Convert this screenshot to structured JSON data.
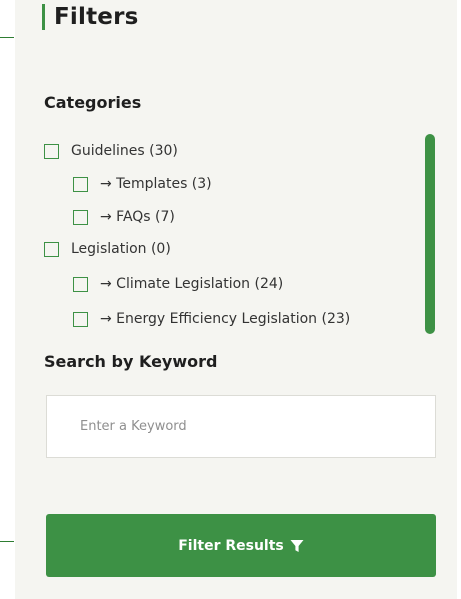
{
  "filters": {
    "title": "Filters",
    "categories_heading": "Categories",
    "categories": [
      {
        "label": "Guidelines (30)",
        "checked": false
      },
      {
        "label": "→ Templates (3)",
        "checked": false
      },
      {
        "label": "→ FAQs (7)",
        "checked": false
      },
      {
        "label": "Legislation (0)",
        "checked": false
      },
      {
        "label": "→ Climate Legislation (24)",
        "checked": false
      },
      {
        "label": "→ Energy Efficiency Legislation (23)",
        "checked": false
      }
    ],
    "keyword_heading": "Search by Keyword",
    "keyword_value": "",
    "keyword_placeholder": "Enter a Keyword",
    "submit_label": "Filter Results",
    "submit_icon": "funnel-icon"
  },
  "colors": {
    "accent": "#3d9145",
    "panel_background": "#f5f5f1",
    "text": "#1f1f1f"
  }
}
